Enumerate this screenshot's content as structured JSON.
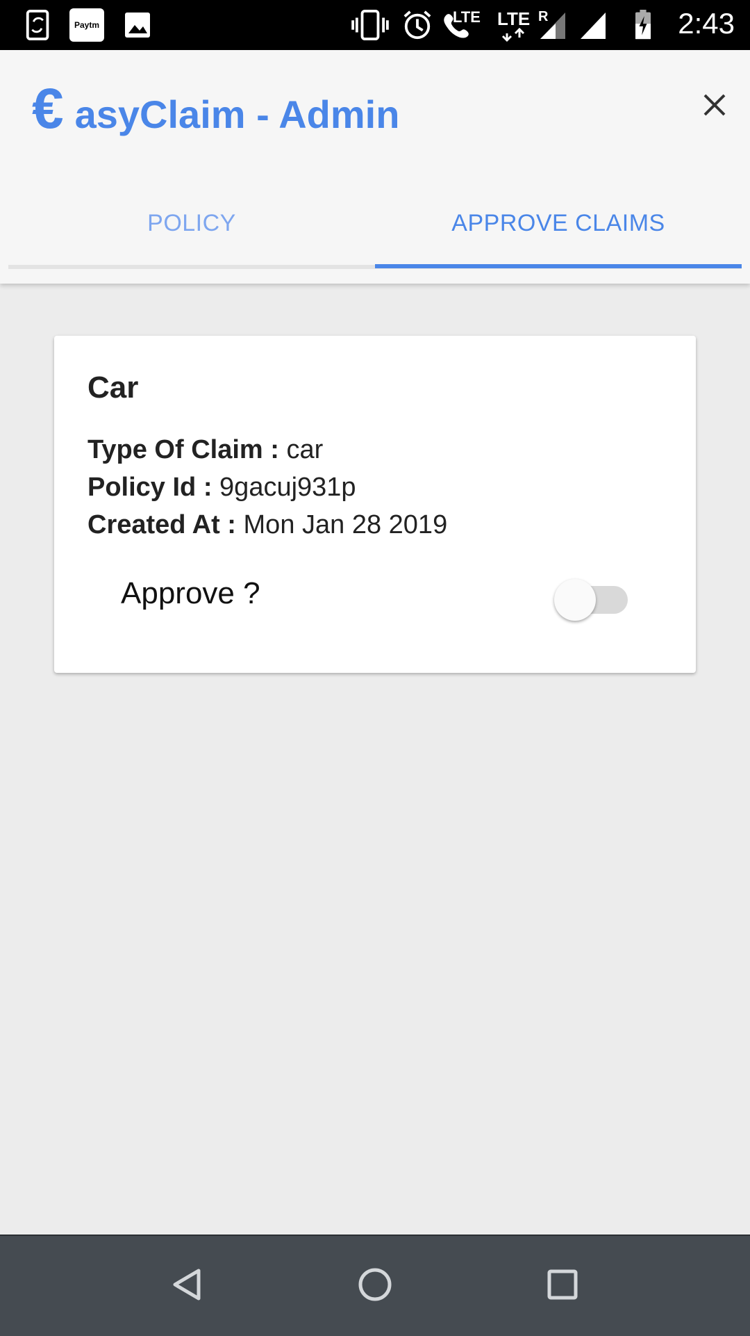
{
  "status_bar": {
    "time": "2:43",
    "lte_label_1": "LTE",
    "lte_label_2": "LTE",
    "roaming": "R",
    "paytm_label": "Paytm"
  },
  "header": {
    "logo_symbol": "€",
    "title": "asyClaim - Admin",
    "accent_color": "#4a86e8"
  },
  "tabs": [
    {
      "label": "POLICY",
      "active": false
    },
    {
      "label": "APPROVE CLAIMS",
      "active": true
    }
  ],
  "claim_card": {
    "title": "Car",
    "type_label": "Type Of Claim :",
    "type_value": "car",
    "policy_label": "Policy Id :",
    "policy_value": "9gacuj931p",
    "created_label": "Created At :",
    "created_value": "Mon Jan 28 2019",
    "approve_label": "Approve ?",
    "approved": false
  },
  "icons": {
    "close": "close-icon",
    "back": "back-icon",
    "home": "home-icon",
    "recents": "recents-icon"
  }
}
